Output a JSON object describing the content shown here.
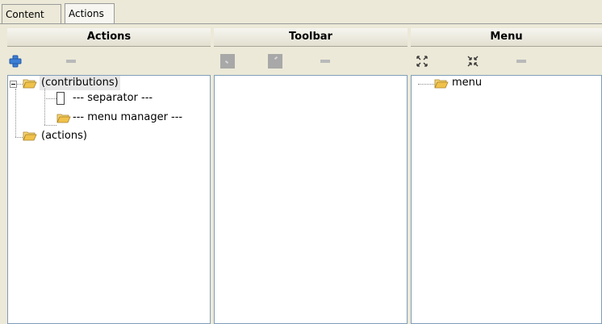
{
  "tabs": [
    {
      "label": "Content",
      "active": false
    },
    {
      "label": "Actions",
      "active": true
    }
  ],
  "panels": {
    "actions": {
      "title": "Actions"
    },
    "toolbar": {
      "title": "Toolbar"
    },
    "menu": {
      "title": "Menu"
    }
  },
  "actions_tree": {
    "contributions": "(contributions)",
    "separator": "--- separator ---",
    "menu_manager": "--- menu manager ---",
    "actions": "(actions)"
  },
  "menu_tree": {
    "menu": "menu"
  },
  "icons": {
    "add": "plus-icon",
    "remove": "minus-icon",
    "expand": "expand-all-icon",
    "collapse": "collapse-all-icon",
    "folder": "folder-open-icon"
  },
  "colors": {
    "window_bg": "#ece9d8",
    "tree_bg": "#ffffff",
    "folder": "#f0c24a",
    "plus": "#3d7fd6"
  }
}
